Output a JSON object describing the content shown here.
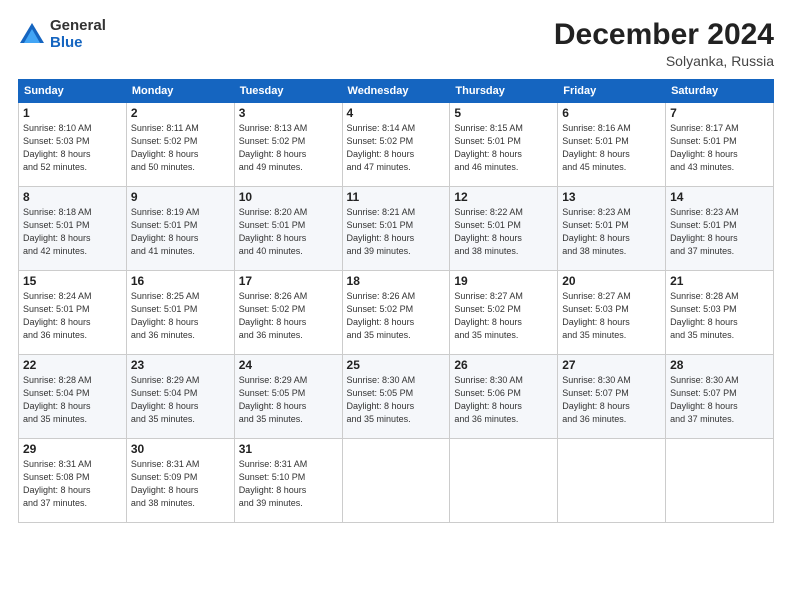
{
  "logo": {
    "general": "General",
    "blue": "Blue"
  },
  "header": {
    "month": "December 2024",
    "location": "Solyanka, Russia"
  },
  "weekdays": [
    "Sunday",
    "Monday",
    "Tuesday",
    "Wednesday",
    "Thursday",
    "Friday",
    "Saturday"
  ],
  "weeks": [
    [
      {
        "day": "1",
        "info": "Sunrise: 8:10 AM\nSunset: 5:03 PM\nDaylight: 8 hours\nand 52 minutes."
      },
      {
        "day": "2",
        "info": "Sunrise: 8:11 AM\nSunset: 5:02 PM\nDaylight: 8 hours\nand 50 minutes."
      },
      {
        "day": "3",
        "info": "Sunrise: 8:13 AM\nSunset: 5:02 PM\nDaylight: 8 hours\nand 49 minutes."
      },
      {
        "day": "4",
        "info": "Sunrise: 8:14 AM\nSunset: 5:02 PM\nDaylight: 8 hours\nand 47 minutes."
      },
      {
        "day": "5",
        "info": "Sunrise: 8:15 AM\nSunset: 5:01 PM\nDaylight: 8 hours\nand 46 minutes."
      },
      {
        "day": "6",
        "info": "Sunrise: 8:16 AM\nSunset: 5:01 PM\nDaylight: 8 hours\nand 45 minutes."
      },
      {
        "day": "7",
        "info": "Sunrise: 8:17 AM\nSunset: 5:01 PM\nDaylight: 8 hours\nand 43 minutes."
      }
    ],
    [
      {
        "day": "8",
        "info": "Sunrise: 8:18 AM\nSunset: 5:01 PM\nDaylight: 8 hours\nand 42 minutes."
      },
      {
        "day": "9",
        "info": "Sunrise: 8:19 AM\nSunset: 5:01 PM\nDaylight: 8 hours\nand 41 minutes."
      },
      {
        "day": "10",
        "info": "Sunrise: 8:20 AM\nSunset: 5:01 PM\nDaylight: 8 hours\nand 40 minutes."
      },
      {
        "day": "11",
        "info": "Sunrise: 8:21 AM\nSunset: 5:01 PM\nDaylight: 8 hours\nand 39 minutes."
      },
      {
        "day": "12",
        "info": "Sunrise: 8:22 AM\nSunset: 5:01 PM\nDaylight: 8 hours\nand 38 minutes."
      },
      {
        "day": "13",
        "info": "Sunrise: 8:23 AM\nSunset: 5:01 PM\nDaylight: 8 hours\nand 38 minutes."
      },
      {
        "day": "14",
        "info": "Sunrise: 8:23 AM\nSunset: 5:01 PM\nDaylight: 8 hours\nand 37 minutes."
      }
    ],
    [
      {
        "day": "15",
        "info": "Sunrise: 8:24 AM\nSunset: 5:01 PM\nDaylight: 8 hours\nand 36 minutes."
      },
      {
        "day": "16",
        "info": "Sunrise: 8:25 AM\nSunset: 5:01 PM\nDaylight: 8 hours\nand 36 minutes."
      },
      {
        "day": "17",
        "info": "Sunrise: 8:26 AM\nSunset: 5:02 PM\nDaylight: 8 hours\nand 36 minutes."
      },
      {
        "day": "18",
        "info": "Sunrise: 8:26 AM\nSunset: 5:02 PM\nDaylight: 8 hours\nand 35 minutes."
      },
      {
        "day": "19",
        "info": "Sunrise: 8:27 AM\nSunset: 5:02 PM\nDaylight: 8 hours\nand 35 minutes."
      },
      {
        "day": "20",
        "info": "Sunrise: 8:27 AM\nSunset: 5:03 PM\nDaylight: 8 hours\nand 35 minutes."
      },
      {
        "day": "21",
        "info": "Sunrise: 8:28 AM\nSunset: 5:03 PM\nDaylight: 8 hours\nand 35 minutes."
      }
    ],
    [
      {
        "day": "22",
        "info": "Sunrise: 8:28 AM\nSunset: 5:04 PM\nDaylight: 8 hours\nand 35 minutes."
      },
      {
        "day": "23",
        "info": "Sunrise: 8:29 AM\nSunset: 5:04 PM\nDaylight: 8 hours\nand 35 minutes."
      },
      {
        "day": "24",
        "info": "Sunrise: 8:29 AM\nSunset: 5:05 PM\nDaylight: 8 hours\nand 35 minutes."
      },
      {
        "day": "25",
        "info": "Sunrise: 8:30 AM\nSunset: 5:05 PM\nDaylight: 8 hours\nand 35 minutes."
      },
      {
        "day": "26",
        "info": "Sunrise: 8:30 AM\nSunset: 5:06 PM\nDaylight: 8 hours\nand 36 minutes."
      },
      {
        "day": "27",
        "info": "Sunrise: 8:30 AM\nSunset: 5:07 PM\nDaylight: 8 hours\nand 36 minutes."
      },
      {
        "day": "28",
        "info": "Sunrise: 8:30 AM\nSunset: 5:07 PM\nDaylight: 8 hours\nand 37 minutes."
      }
    ],
    [
      {
        "day": "29",
        "info": "Sunrise: 8:31 AM\nSunset: 5:08 PM\nDaylight: 8 hours\nand 37 minutes."
      },
      {
        "day": "30",
        "info": "Sunrise: 8:31 AM\nSunset: 5:09 PM\nDaylight: 8 hours\nand 38 minutes."
      },
      {
        "day": "31",
        "info": "Sunrise: 8:31 AM\nSunset: 5:10 PM\nDaylight: 8 hours\nand 39 minutes."
      },
      {
        "day": "",
        "info": ""
      },
      {
        "day": "",
        "info": ""
      },
      {
        "day": "",
        "info": ""
      },
      {
        "day": "",
        "info": ""
      }
    ]
  ]
}
